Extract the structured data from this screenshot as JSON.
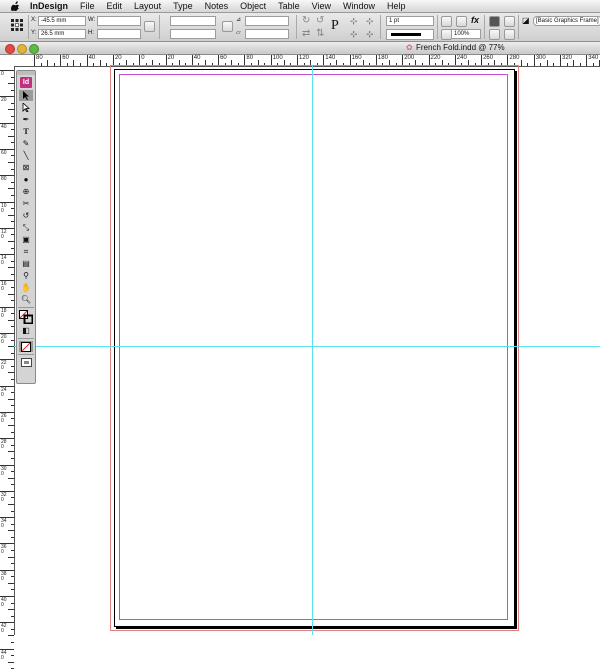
{
  "menubar": {
    "app_name": "InDesign",
    "items": [
      "File",
      "Edit",
      "Layout",
      "Type",
      "Notes",
      "Object",
      "Table",
      "View",
      "Window",
      "Help"
    ]
  },
  "control_panel": {
    "x_label": "X:",
    "x_value": "-45.5 mm",
    "y_label": "Y:",
    "y_value": "26.5 mm",
    "w_label": "W:",
    "h_label": "H:",
    "stroke_weight": "1 pt",
    "opacity": "100%",
    "object_style": "[Basic Graphics Frame]"
  },
  "document": {
    "title": "French Fold.indd @ 77%"
  },
  "horizontal_ruler_labels": [
    "80",
    "60",
    "40",
    "20",
    "0",
    "20",
    "40",
    "60",
    "80",
    "100",
    "120",
    "140",
    "160",
    "180",
    "200",
    "220",
    "240",
    "260",
    "280",
    "300",
    "320",
    "340"
  ],
  "vertical_ruler_labels": [
    "0",
    "20",
    "40",
    "60",
    "80",
    "100",
    "120",
    "140",
    "160",
    "180",
    "200",
    "220",
    "240",
    "260",
    "280",
    "300",
    "320",
    "340",
    "360",
    "380",
    "400",
    "420",
    "440"
  ],
  "tools_panel": {
    "badge": "Id",
    "tools": [
      "selection-tool",
      "direct-selection-tool",
      "pen-tool",
      "type-tool",
      "pencil-tool",
      "line-tool",
      "rectangle-frame-tool",
      "ellipse-tool",
      "position-tool",
      "scissors-tool",
      "rotate-tool",
      "scale-tool",
      "gradient-tool",
      "free-transform-tool",
      "note-tool",
      "eyedropper-tool",
      "hand-tool",
      "zoom-tool"
    ]
  },
  "colors": {
    "guide": "#5be3ef",
    "margin": "#c64bd6",
    "bleed": "#e08080",
    "badge": "#c2307f"
  }
}
